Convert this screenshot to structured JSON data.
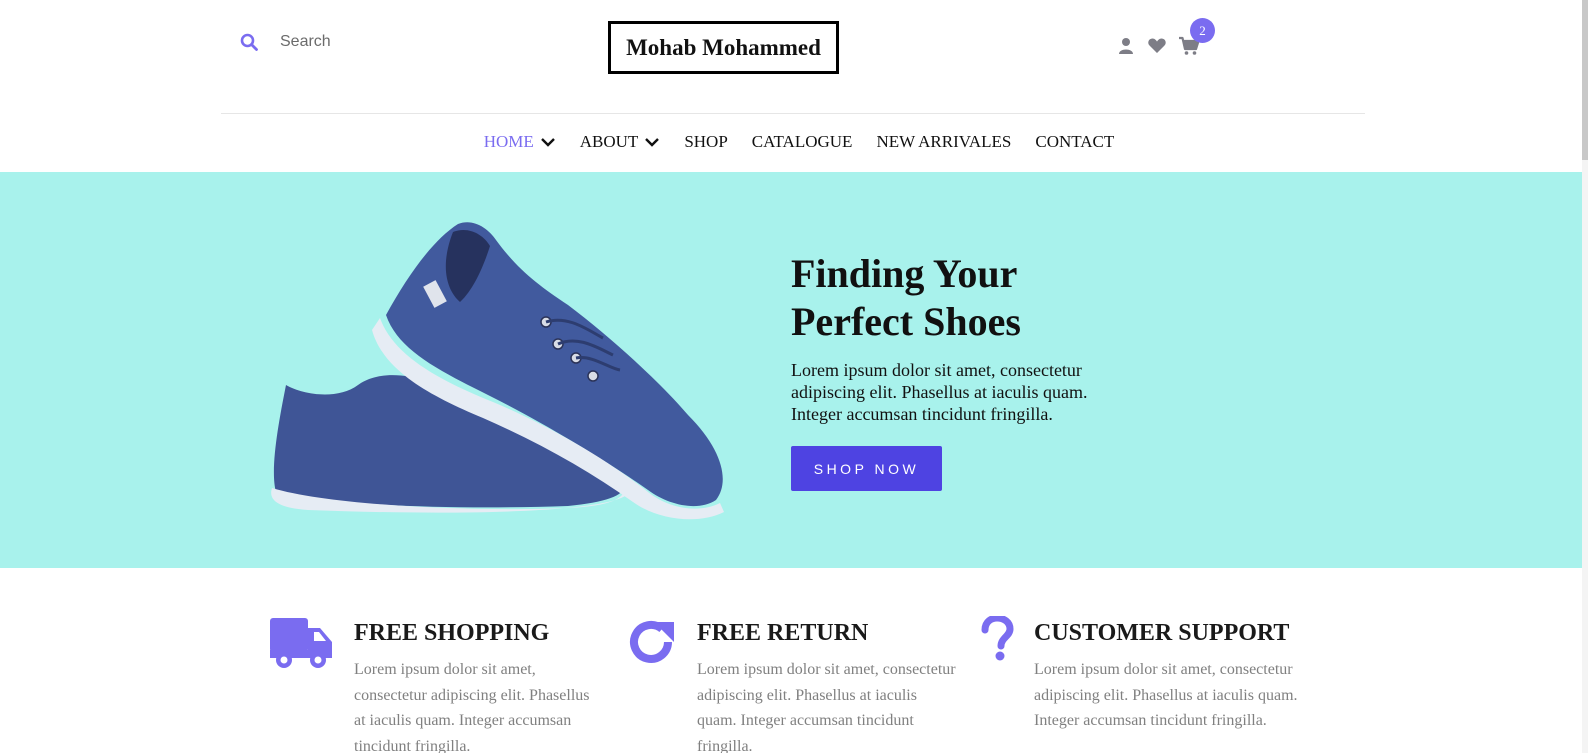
{
  "header": {
    "search_placeholder": "Search",
    "logo": "Mohab Mohammed",
    "cart_count": "2",
    "icons": [
      "search-icon",
      "user-icon",
      "heart-icon",
      "cart-icon"
    ]
  },
  "nav": {
    "items": [
      {
        "label": "HOME",
        "has_dropdown": true,
        "active": true
      },
      {
        "label": "ABOUT",
        "has_dropdown": true,
        "active": false
      },
      {
        "label": "SHOP",
        "has_dropdown": false,
        "active": false
      },
      {
        "label": "CATALOGUE",
        "has_dropdown": false,
        "active": false
      },
      {
        "label": "NEW ARRIVALES",
        "has_dropdown": false,
        "active": false
      },
      {
        "label": "CONTACT",
        "has_dropdown": false,
        "active": false
      }
    ]
  },
  "hero": {
    "title_line1": "Finding Your",
    "title_line2": "Perfect Shoes",
    "text": "Lorem ipsum dolor sit amet, consectetur adipiscing elit. Phasellus at iaculis quam. Integer accumsan tincidunt fringilla.",
    "button": "SHOP NOW"
  },
  "features": [
    {
      "icon": "truck-icon",
      "title": "FREE SHOPPING",
      "text": "Lorem ipsum dolor sit amet, consectetur adipiscing elit. Phasellus at iaculis quam. Integer accumsan tincidunt fringilla."
    },
    {
      "icon": "redo-icon",
      "title": "FREE RETURN",
      "text": "Lorem ipsum dolor sit amet, consectetur adipiscing elit. Phasellus at iaculis quam. Integer accumsan tincidunt fringilla."
    },
    {
      "icon": "question-icon",
      "title": "CUSTOMER SUPPORT",
      "text": "Lorem ipsum dolor sit amet, consectetur adipiscing elit. Phasellus at iaculis quam. Integer accumsan tincidunt fringilla."
    }
  ],
  "colors": {
    "accent": "#7a6cf0",
    "button": "#4e43e2",
    "hero_bg": "#a8f2ec",
    "icon_gray": "#7d7d86"
  }
}
